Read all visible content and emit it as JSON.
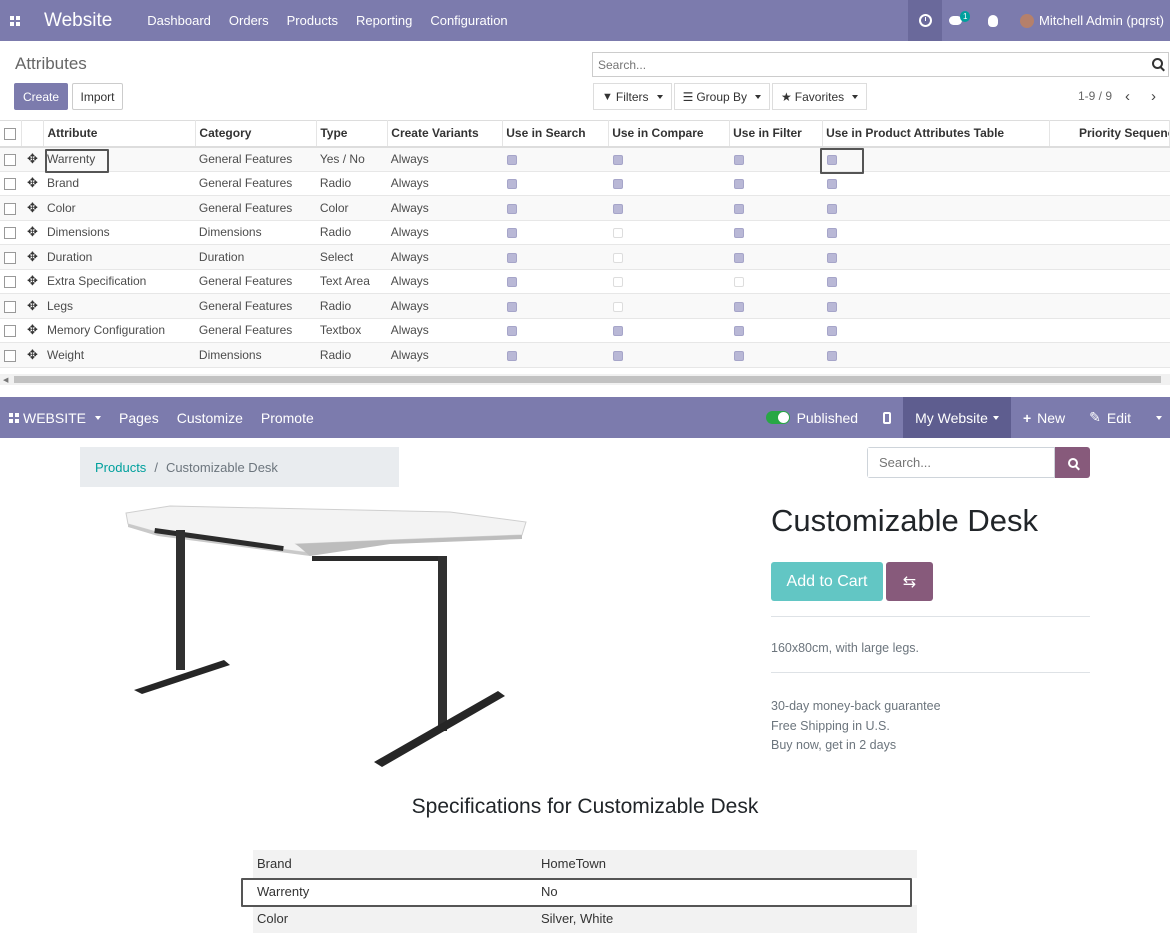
{
  "topbar": {
    "app_title": "Website",
    "menu": [
      "Dashboard",
      "Orders",
      "Products",
      "Reporting",
      "Configuration"
    ],
    "chat_badge": "1",
    "user": "Mitchell Admin (pqrst)"
  },
  "control_panel": {
    "title": "Attributes",
    "search_placeholder": "Search...",
    "create_label": "Create",
    "import_label": "Import",
    "filters_label": "Filters",
    "groupby_label": "Group By",
    "favorites_label": "Favorites",
    "pager": "1-9 / 9"
  },
  "table": {
    "columns": [
      "Attribute",
      "Category",
      "Type",
      "Create Variants",
      "Use in Search",
      "Use in Compare",
      "Use in Filter",
      "Use in Product Attributes Table",
      "Priority Sequence"
    ],
    "rows": [
      {
        "attribute": "Warrenty",
        "category": "General Features",
        "type": "Yes / No",
        "variants": "Always",
        "search": true,
        "compare": true,
        "filter": true,
        "table": true
      },
      {
        "attribute": "Brand",
        "category": "General Features",
        "type": "Radio",
        "variants": "Always",
        "search": true,
        "compare": true,
        "filter": true,
        "table": true
      },
      {
        "attribute": "Color",
        "category": "General Features",
        "type": "Color",
        "variants": "Always",
        "search": true,
        "compare": true,
        "filter": true,
        "table": true
      },
      {
        "attribute": "Dimensions",
        "category": "Dimensions",
        "type": "Radio",
        "variants": "Always",
        "search": true,
        "compare": false,
        "filter": true,
        "table": true
      },
      {
        "attribute": "Duration",
        "category": "Duration",
        "type": "Select",
        "variants": "Always",
        "search": true,
        "compare": false,
        "filter": true,
        "table": true
      },
      {
        "attribute": "Extra Specification",
        "category": "General Features",
        "type": "Text Area",
        "variants": "Always",
        "search": true,
        "compare": false,
        "filter": false,
        "table": true
      },
      {
        "attribute": "Legs",
        "category": "General Features",
        "type": "Radio",
        "variants": "Always",
        "search": true,
        "compare": false,
        "filter": true,
        "table": true
      },
      {
        "attribute": "Memory Configuration",
        "category": "General Features",
        "type": "Textbox",
        "variants": "Always",
        "search": true,
        "compare": true,
        "filter": true,
        "table": true
      },
      {
        "attribute": "Weight",
        "category": "Dimensions",
        "type": "Radio",
        "variants": "Always",
        "search": true,
        "compare": true,
        "filter": true,
        "table": true
      }
    ]
  },
  "website_bar": {
    "website_label": "WEBSITE",
    "pages_label": "Pages",
    "customize_label": "Customize",
    "promote_label": "Promote",
    "published_label": "Published",
    "my_website_label": "My Website",
    "new_label": "New",
    "edit_label": "Edit"
  },
  "product": {
    "breadcrumb_link": "Products",
    "breadcrumb_sep": "/",
    "breadcrumb_current": "Customizable Desk",
    "search_placeholder": "Search...",
    "name": "Customizable Desk",
    "add_to_cart": "Add to Cart",
    "description": "160x80cm, with large legs.",
    "notes": [
      "30-day money-back guarantee",
      "Free Shipping in U.S.",
      "Buy now, get in 2 days"
    ],
    "spec_title": "Specifications for Customizable Desk",
    "specs": [
      {
        "name": "Brand",
        "value": "HomeTown"
      },
      {
        "name": "Warrenty",
        "value": "No"
      },
      {
        "name": "Color",
        "value": "Silver, White"
      }
    ]
  },
  "colors": {
    "brand_purple": "#7c7bad",
    "website_accent": "#875a7b",
    "link_teal": "#00a09d",
    "cart_teal": "#62c6c4"
  }
}
